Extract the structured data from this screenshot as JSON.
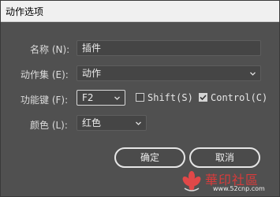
{
  "window": {
    "title": "动作选项"
  },
  "form": {
    "name": {
      "label": "名称 (N):",
      "value": "插件"
    },
    "action_set": {
      "label": "动作集 (E):",
      "value": "动作"
    },
    "function_key": {
      "label": "功能键 (F):",
      "value": "F2",
      "shift": {
        "label": "Shift(S)",
        "checked": false
      },
      "control": {
        "label": "Control(C)",
        "checked": true
      }
    },
    "color": {
      "label": "颜色 (L):",
      "value": "红色"
    }
  },
  "buttons": {
    "ok": "确定",
    "cancel": "取消"
  },
  "watermark": {
    "text": "華印社區",
    "url": "www.52cnp.com"
  }
}
